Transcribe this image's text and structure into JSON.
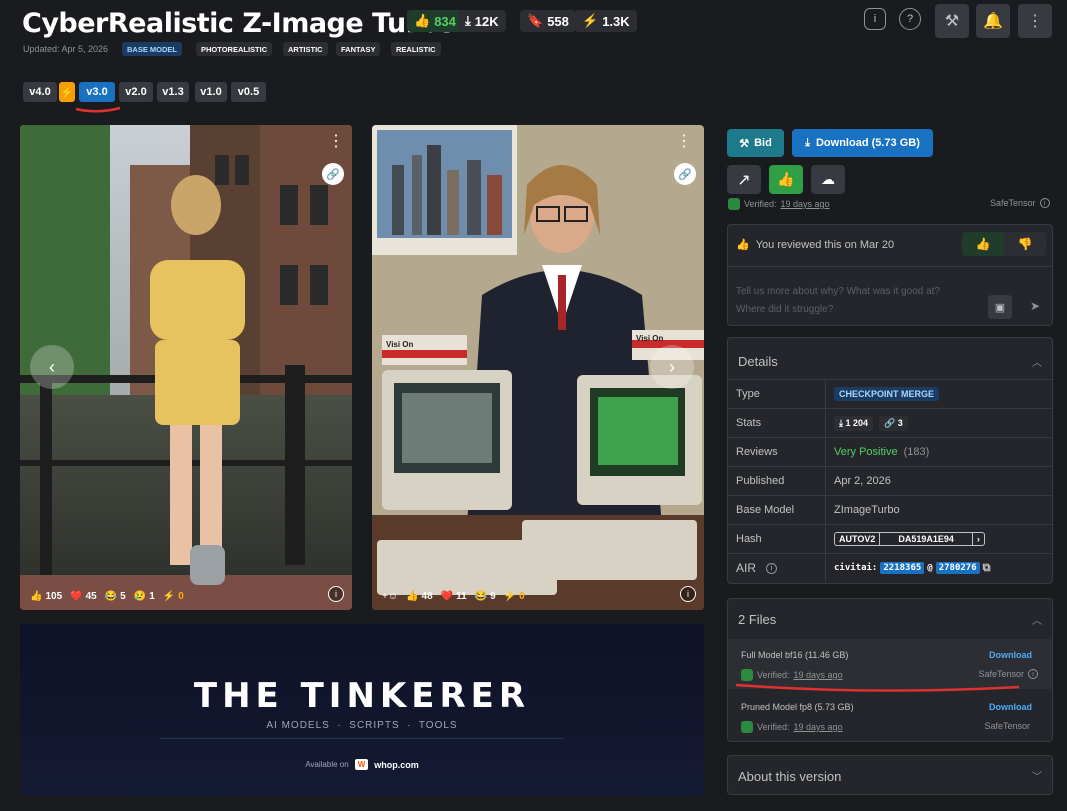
{
  "title": "CyberRealistic Z-Image Turbo",
  "stats": {
    "likes": "834",
    "downloads": "12K",
    "bookmarks": "558",
    "buzz": "1.3K"
  },
  "updated": "Updated: Apr 5, 2026",
  "tags": [
    "BASE MODEL",
    "PHOTOREALISTIC",
    "ARTISTIC",
    "FANTASY",
    "REALISTIC"
  ],
  "versions": [
    "v4.0",
    "v3.0",
    "v2.0",
    "v1.3",
    "v1.0",
    "v0.5"
  ],
  "gallery": [
    {
      "reactions": {
        "like": "105",
        "heart": "45",
        "laugh": "5",
        "cry": "1",
        "buzz": "0"
      }
    },
    {
      "reactions": {
        "like": "48",
        "heart": "11",
        "laugh": "9",
        "buzz": "0"
      }
    }
  ],
  "banner": {
    "title": "THE TINKERER",
    "subtitle": "AI MODELS  ·  SCRIPTS  ·  TOOLS",
    "available": "Available on",
    "platform": "whop.com"
  },
  "actions": {
    "bid": "Bid",
    "download": "Download (5.73 GB)"
  },
  "verified": {
    "label": "Verified:",
    "ago": "19 days ago",
    "format": "SafeTensor"
  },
  "review": {
    "text": "You reviewed this on Mar 20",
    "placeholder": "Tell us more about why? What was it good at?\nWhere did it struggle?"
  },
  "details": {
    "header": "Details",
    "type_label": "Type",
    "type": "CHECKPOINT MERGE",
    "stats_label": "Stats",
    "dl_count": "1 204",
    "gen_count": "3",
    "reviews_label": "Reviews",
    "reviews": "Very Positive",
    "reviews_count": "(183)",
    "published_label": "Published",
    "published": "Apr 2, 2026",
    "base_label": "Base Model",
    "base": "ZImageTurbo",
    "hash_label": "Hash",
    "hash_type": "AUTOV2",
    "hash": "DA519A1E94",
    "air_label": "AIR",
    "air_prefix": "civitai:",
    "air_id1": "2218365",
    "air_at": "@",
    "air_id2": "2780276"
  },
  "files": {
    "header": "2 Files",
    "items": [
      {
        "name": "Full Model bf16 (11.46 GB)",
        "download": "Download",
        "verified": "Verified:",
        "ago": "19 days ago",
        "format": "SafeTensor"
      },
      {
        "name": "Pruned Model fp8 (5.73 GB)",
        "download": "Download",
        "verified": "Verified:",
        "ago": "19 days ago",
        "format": "SafeTensor"
      }
    ]
  },
  "about": "About this version"
}
